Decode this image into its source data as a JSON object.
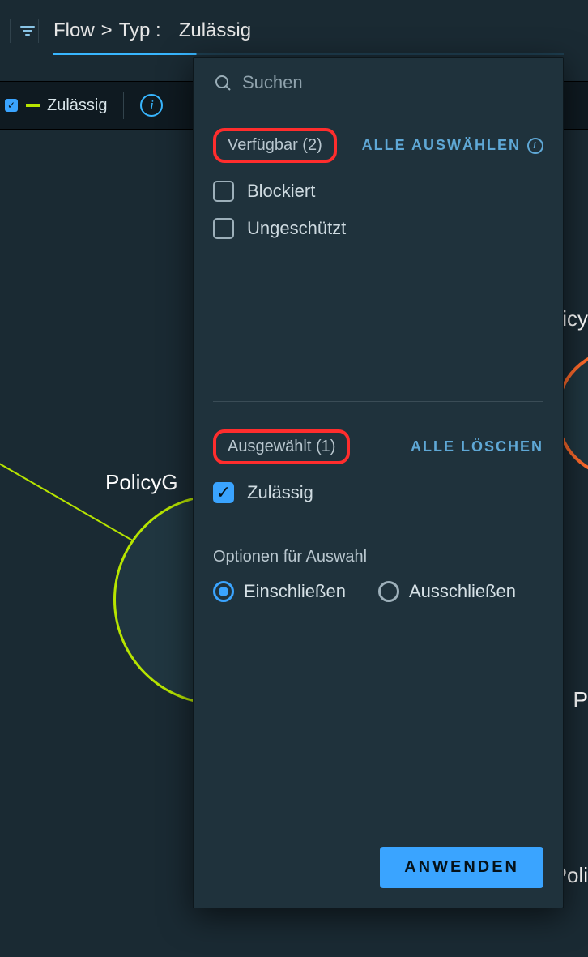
{
  "breadcrumb": {
    "path1": "Flow",
    "sep": ">",
    "path2": "Typ :",
    "value": "Zulässig"
  },
  "chip": {
    "label": "Zulässig"
  },
  "panel": {
    "search_placeholder": "Suchen",
    "available": {
      "label": "Verfügbar (2)",
      "select_all": "ALLE AUSWÄHLEN"
    },
    "available_options": [
      {
        "label": "Blockiert",
        "checked": false
      },
      {
        "label": "Ungeschützt",
        "checked": false
      }
    ],
    "selected": {
      "label": "Ausgewählt (1)",
      "clear_all": "ALLE LÖSCHEN"
    },
    "selected_options": [
      {
        "label": "Zulässig",
        "checked": true
      }
    ],
    "selection_options_title": "Optionen für Auswahl",
    "radios": {
      "include": "Einschließen",
      "exclude": "Ausschließen",
      "selected": "include"
    },
    "apply": "ANWENDEN"
  },
  "bg": {
    "node_label": "PolicyG",
    "right_label": "icy",
    "right_p": "P",
    "right_poli": "Poli"
  }
}
